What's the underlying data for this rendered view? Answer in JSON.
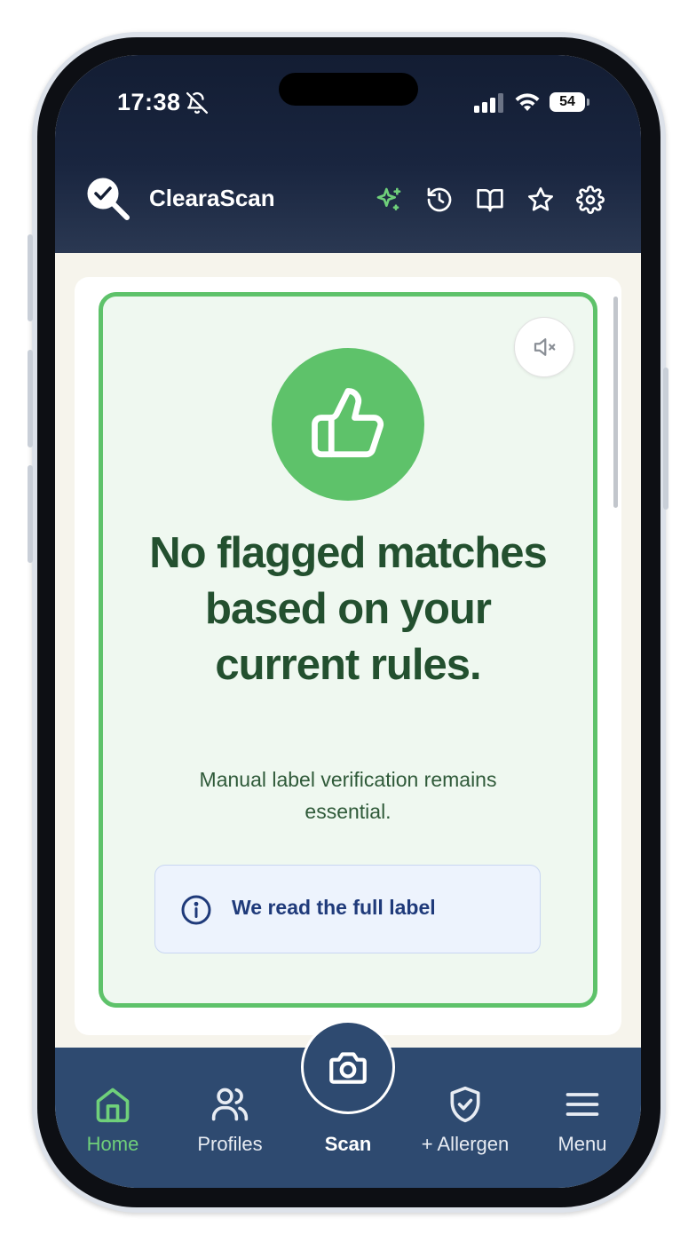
{
  "status_bar": {
    "time": "17:38",
    "battery": "54",
    "icons": [
      "bell-off-icon",
      "cellular-signal-icon",
      "wifi-icon",
      "battery-icon"
    ]
  },
  "header": {
    "app_name": "ClearaScan",
    "actions": [
      {
        "name": "ai-sparkle",
        "icon": "sparkle-icon",
        "color": "#6fd07a"
      },
      {
        "name": "history",
        "icon": "history-icon"
      },
      {
        "name": "guide",
        "icon": "book-icon"
      },
      {
        "name": "favorites",
        "icon": "star-icon"
      },
      {
        "name": "settings",
        "icon": "gear-icon"
      }
    ]
  },
  "result": {
    "headline": "No flagged matches based on your current rules.",
    "subtext": "Manual label verification remains essential.",
    "info_text": "We read the full label",
    "mute_icon": "speaker-muted-icon",
    "status_icon": "thumbs-up-icon",
    "accent_color": "#5ec26a",
    "text_color": "#23502f"
  },
  "nav": {
    "items": [
      {
        "label": "Home",
        "icon": "home-icon",
        "active": true
      },
      {
        "label": "Profiles",
        "icon": "users-icon",
        "active": false
      },
      {
        "label": "Scan",
        "icon": "camera-icon",
        "active": false
      },
      {
        "label": "+ Allergen",
        "icon": "shield-check-icon",
        "active": false
      },
      {
        "label": "Menu",
        "icon": "hamburger-menu-icon",
        "active": false
      }
    ],
    "background": "#2e4a70",
    "active_color": "#6fd07a"
  }
}
